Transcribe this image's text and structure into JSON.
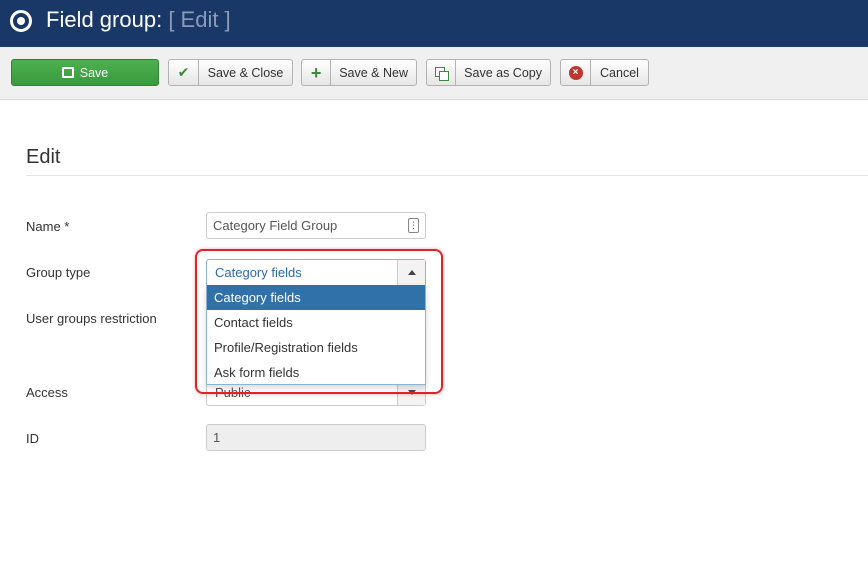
{
  "header": {
    "title": "Field group:",
    "subtitle": "[ Edit ]",
    "icon": "target-icon"
  },
  "toolbar": {
    "save_label": "Save",
    "save_close_label": "Save & Close",
    "save_new_label": "Save & New",
    "save_copy_label": "Save as Copy",
    "cancel_label": "Cancel"
  },
  "form": {
    "legend": "Edit",
    "name_label": "Name *",
    "name_value": "Category Field Group",
    "group_type_label": "Group type",
    "group_type_value": "Category fields",
    "group_type_options": [
      "Category fields",
      "Contact fields",
      "Profile/Registration fields",
      "Ask form fields"
    ],
    "user_groups_label": "User groups restriction",
    "access_label": "Access",
    "access_value": "Public",
    "id_label": "ID",
    "id_value": "1"
  },
  "colors": {
    "header_bg": "#1a3867",
    "save_green": "#43a047",
    "selected_option": "#3071a9",
    "highlight_red": "#e2222a"
  }
}
